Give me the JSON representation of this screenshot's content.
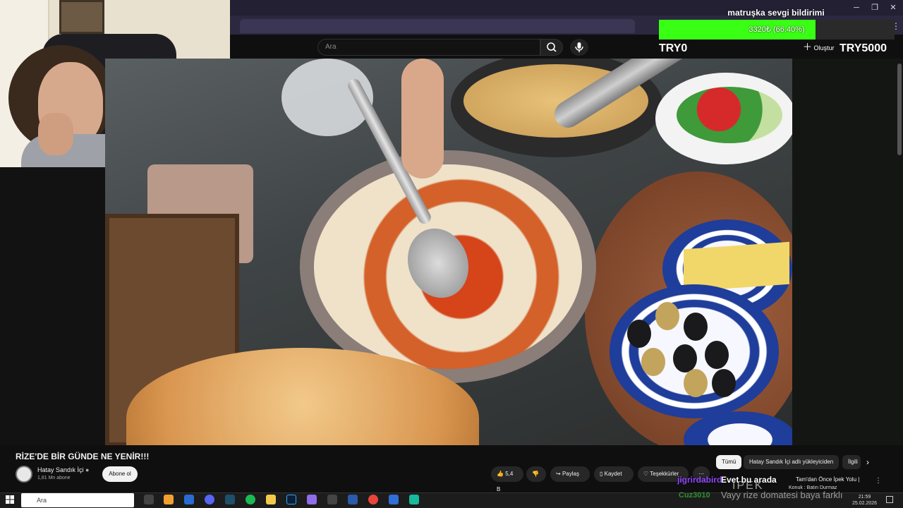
{
  "overlay": {
    "donation_title": "matruşka sevgi bildirimi",
    "goal_text": "3320₺ (66.40%)",
    "goal_fraction": 0.664,
    "goal_min": "TRY0",
    "goal_max": "TRY5000",
    "goal_color": "#39ff14"
  },
  "youtube": {
    "search_placeholder": "Ara",
    "create_label": "Oluştur",
    "video_title": "RİZE'DE BİR GÜNDE NE YENİR!!!",
    "channel_name": "Hatay Sandık İçi",
    "channel_subs": "1,81 Mn abone",
    "subscribe_label": "Abone ol",
    "like_count": "5,4 B",
    "share_label": "Paylaş",
    "save_label": "Kaydet",
    "thanks_label": "Teşekkürler",
    "chips": [
      "Tümü",
      "Hatay Sandık İçi adlı yükleyiciden",
      "İlgili"
    ],
    "rec_title": "Tam'dan Önce İpek Yolu |",
    "rec_sub": "Konuk : Batın Durmaz"
  },
  "chat": {
    "user1": "jigrirdabird",
    "msg1": "Evet bu arada",
    "user2": "Cuz3010",
    "msg2": "Vayy rize domatesi baya farklı",
    "watermark": "İPEK"
  },
  "taskbar": {
    "search_label": "Ara",
    "time": "21:59",
    "date": "25.02.2026"
  }
}
